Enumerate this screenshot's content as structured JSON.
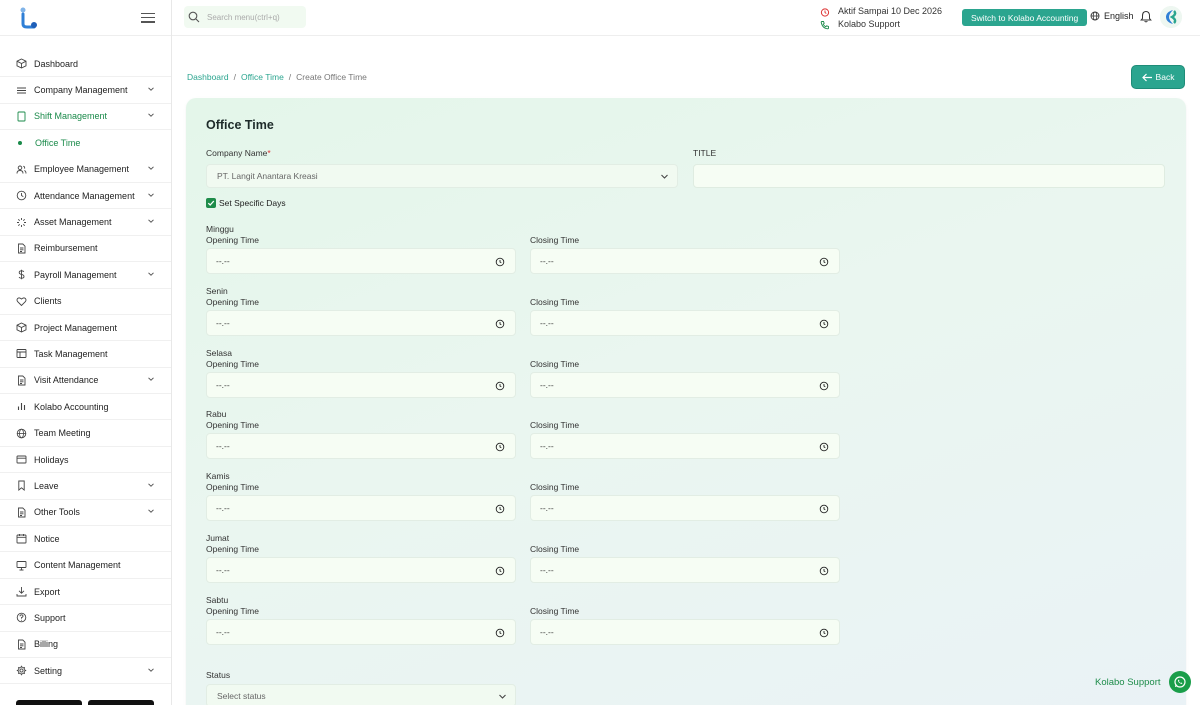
{
  "app": {
    "brand_color": "#2ba58f",
    "accent_green": "#1a8a4a"
  },
  "sidebar": {
    "items": [
      {
        "label": "Dashboard",
        "icon": "cube-icon",
        "chevron": false
      },
      {
        "label": "Company Management",
        "icon": "list-icon",
        "chevron": true
      },
      {
        "label": "Shift Management",
        "icon": "book-icon",
        "chevron": true,
        "active": true
      },
      {
        "label": "Office Time",
        "sub": true
      },
      {
        "label": "Employee Management",
        "icon": "users-icon",
        "chevron": true
      },
      {
        "label": "Attendance Management",
        "icon": "clock-icon",
        "chevron": true
      },
      {
        "label": "Asset Management",
        "icon": "loader-icon",
        "chevron": true
      },
      {
        "label": "Reimbursement",
        "icon": "file-icon",
        "chevron": false
      },
      {
        "label": "Payroll Management",
        "icon": "dollar-icon",
        "chevron": true
      },
      {
        "label": "Clients",
        "icon": "heart-icon",
        "chevron": false
      },
      {
        "label": "Project Management",
        "icon": "box-icon",
        "chevron": false
      },
      {
        "label": "Task Management",
        "icon": "table-icon",
        "chevron": false
      },
      {
        "label": "Visit Attendance",
        "icon": "file-icon",
        "chevron": true
      },
      {
        "label": "Kolabo Accounting",
        "icon": "bar-chart-icon",
        "chevron": false
      },
      {
        "label": "Team Meeting",
        "icon": "globe-icon",
        "chevron": false
      },
      {
        "label": "Holidays",
        "icon": "card-icon",
        "chevron": false
      },
      {
        "label": "Leave",
        "icon": "bookmark-icon",
        "chevron": true
      },
      {
        "label": "Other Tools",
        "icon": "file-icon",
        "chevron": true
      },
      {
        "label": "Notice",
        "icon": "calendar-icon",
        "chevron": false
      },
      {
        "label": "Content Management",
        "icon": "monitor-icon",
        "chevron": false
      },
      {
        "label": "Export",
        "icon": "download-icon",
        "chevron": false
      },
      {
        "label": "Support",
        "icon": "help-icon",
        "chevron": false
      },
      {
        "label": "Billing",
        "icon": "file-icon",
        "chevron": false
      },
      {
        "label": "Setting",
        "icon": "gear-icon",
        "chevron": true
      }
    ]
  },
  "topbar": {
    "search_placeholder": "Search menu(ctrl+q)",
    "active_until": "Aktif Sampai 10 Dec 2026",
    "support": "Kolabo Support",
    "switch_label": "Switch to Kolabo Accounting",
    "language": "English"
  },
  "breadcrumb": {
    "home": "Dashboard",
    "section": "Office Time",
    "current": "Create Office Time",
    "sep": "/"
  },
  "back_label": "Back",
  "form": {
    "title": "Office Time",
    "company_label": "Company Name",
    "company_required": "*",
    "company_value": "PT. Langit Anantara Kreasi",
    "title_label": "TITLE",
    "title_value": "",
    "specific_days_label": "Set Specific Days",
    "specific_days_checked": true,
    "opening_label": "Opening Time",
    "closing_label": "Closing Time",
    "time_placeholder": "--.--",
    "days": [
      "Minggu",
      "Senin",
      "Selasa",
      "Rabu",
      "Kamis",
      "Jumat",
      "Sabtu"
    ],
    "status_label": "Status",
    "status_placeholder": "Select status"
  },
  "whatsapp": {
    "label": "Kolabo Support"
  }
}
